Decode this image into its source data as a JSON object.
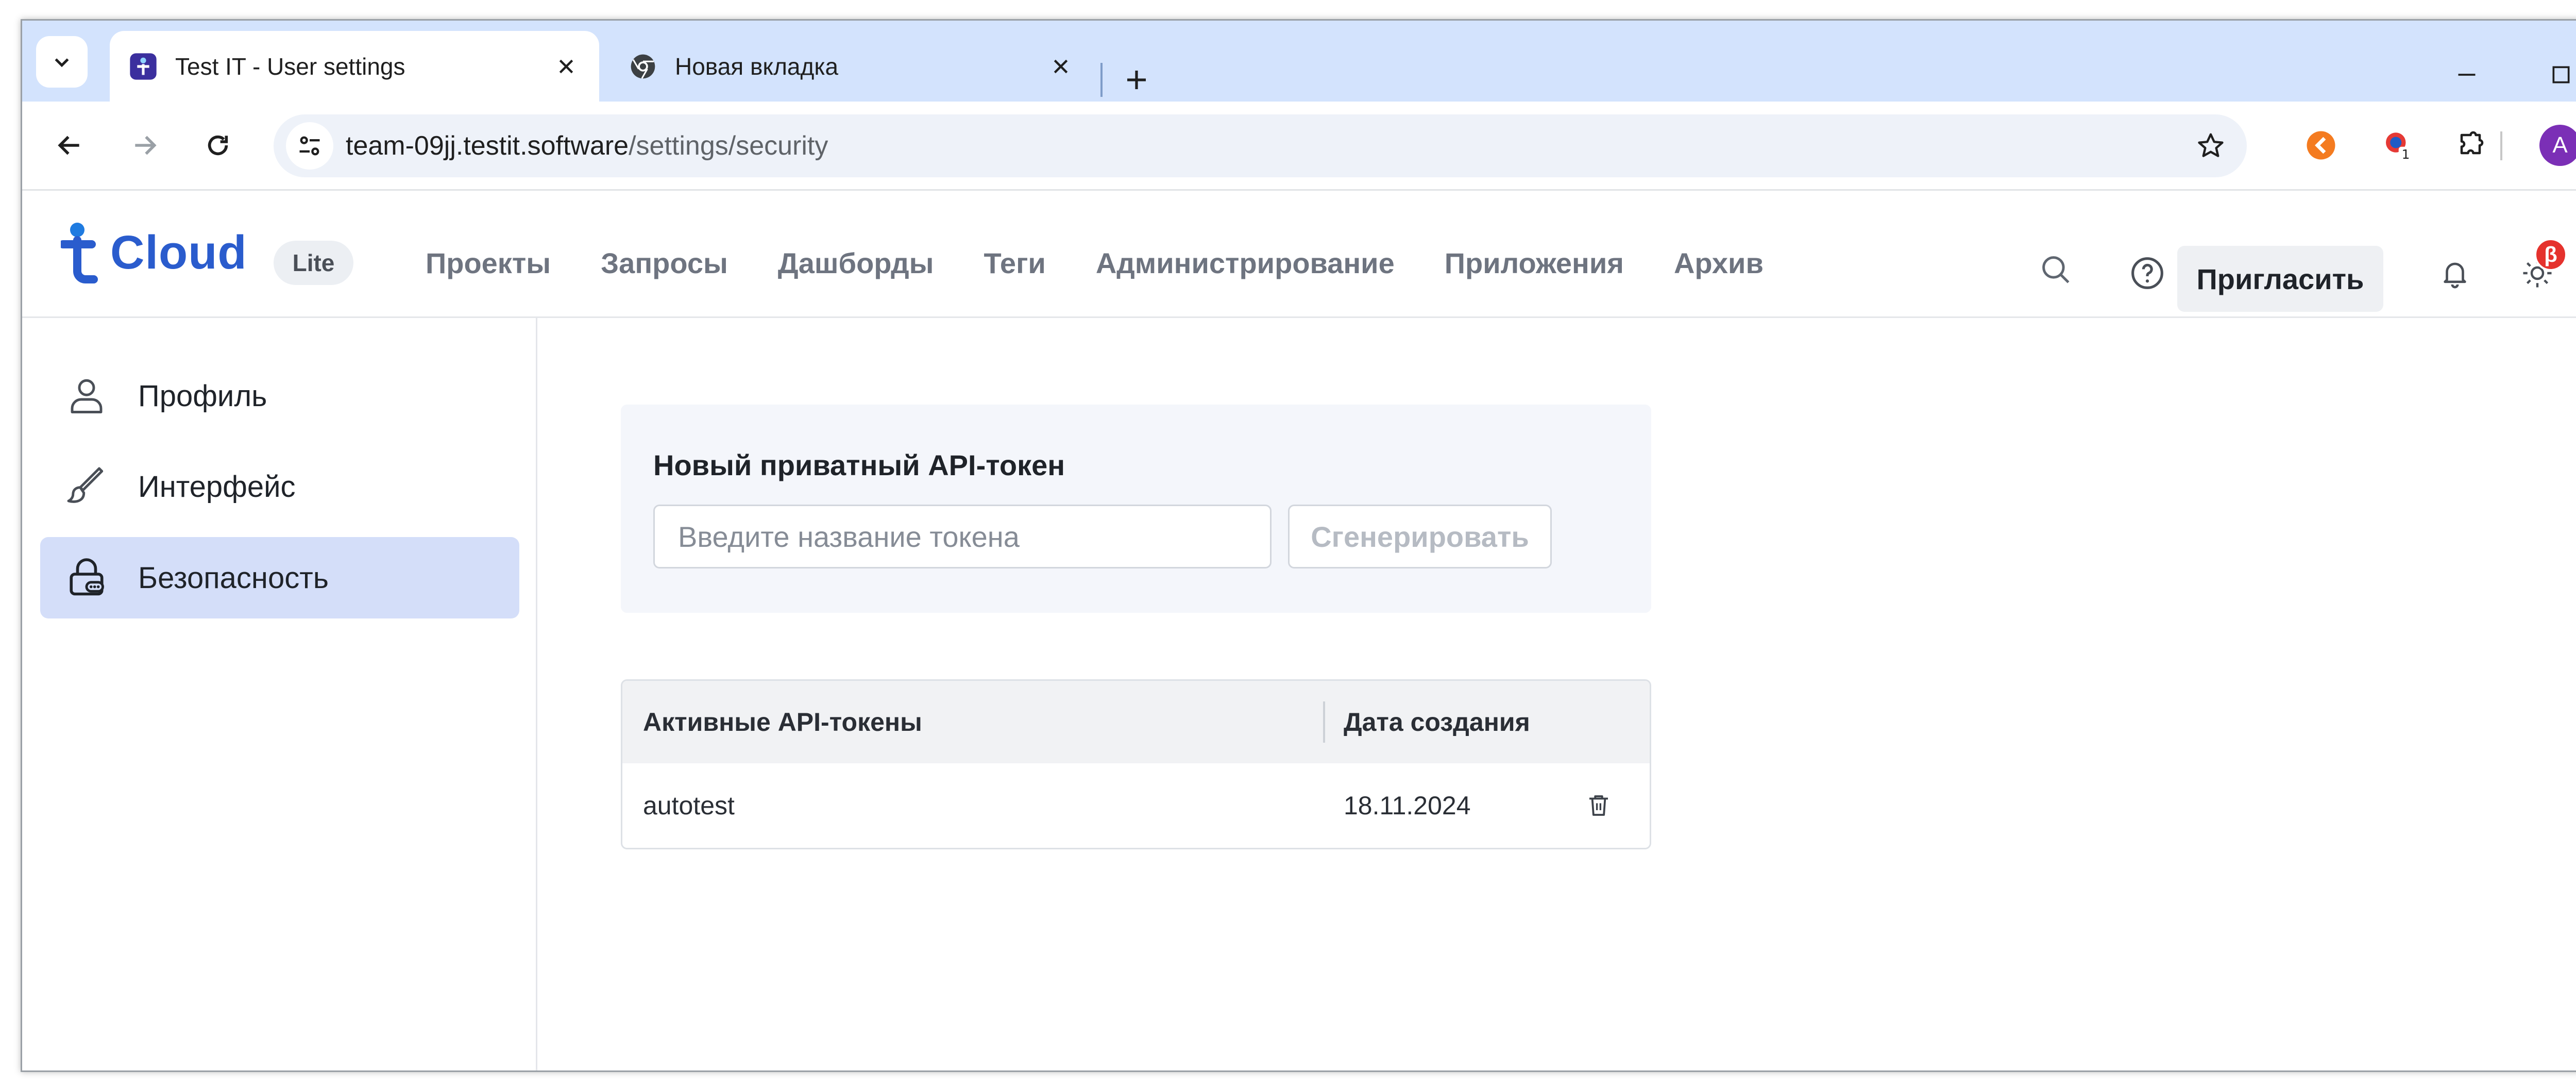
{
  "browser": {
    "tabs": [
      {
        "title": "Test IT - User settings",
        "active": true
      },
      {
        "title": "Новая вкладка",
        "active": false
      }
    ],
    "address": {
      "host": "team-09jj.testit.software",
      "path": "/settings/security"
    },
    "profile_initial": "A",
    "extension_badge": "1"
  },
  "app": {
    "logo_text": "Cloud",
    "plan_badge": "Lite",
    "nav": [
      "Проекты",
      "Запросы",
      "Дашборды",
      "Теги",
      "Администрирование",
      "Приложения",
      "Архив"
    ],
    "invite_label": "Пригласить",
    "beta_badge": "β",
    "avatar_initial": "A"
  },
  "sidebar": {
    "items": [
      {
        "label": "Профиль",
        "icon": "user-icon",
        "active": false
      },
      {
        "label": "Интерфейс",
        "icon": "brush-icon",
        "active": false
      },
      {
        "label": "Безопасность",
        "icon": "lock-icon",
        "active": true
      }
    ]
  },
  "token_form": {
    "title": "Новый приватный API-токен",
    "input_placeholder": "Введите название токена",
    "input_value": "",
    "generate_label": "Сгенерировать"
  },
  "tokens_table": {
    "columns": [
      "Активные API-токены",
      "Дата создания"
    ],
    "rows": [
      {
        "name": "autotest",
        "created": "18.11.2024"
      }
    ]
  },
  "colors": {
    "tabstrip": "#d3e3fd",
    "brand": "#2a5ccd",
    "active_sidebar": "#d4def9",
    "card_bg": "#f4f6fb",
    "beta": "#e5322d",
    "profile": "#7b2fb6"
  }
}
